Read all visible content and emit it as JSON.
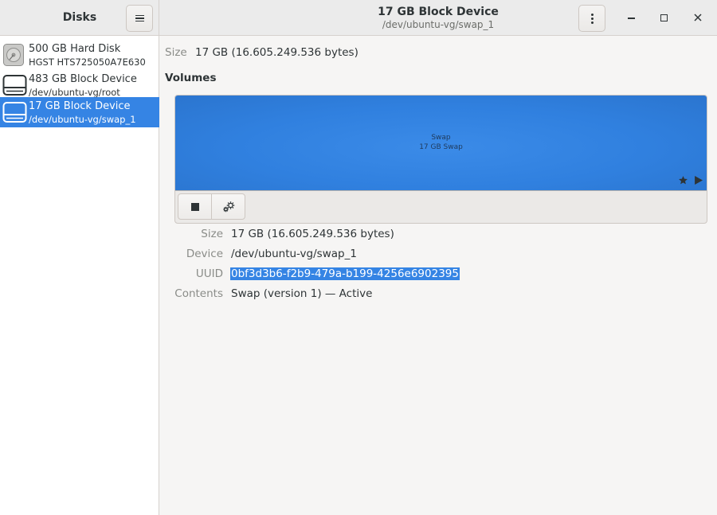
{
  "app": {
    "title": "Disks"
  },
  "header": {
    "device_title": "17 GB Block Device",
    "device_subtitle": "/dev/ubuntu-vg/swap_1"
  },
  "sidebar": {
    "items": [
      {
        "name": "500 GB Hard Disk",
        "sub": "HGST HTS725050A7E630",
        "icon": "hard-disk-icon",
        "selected": false
      },
      {
        "name": "483 GB Block Device",
        "sub": "/dev/ubuntu-vg/root",
        "icon": "block-device-icon",
        "selected": false
      },
      {
        "name": "17 GB Block Device",
        "sub": "/dev/ubuntu-vg/swap_1",
        "icon": "block-device-icon",
        "selected": true
      }
    ]
  },
  "device": {
    "size_label": "Size",
    "size_value": "17 GB (16.605.249.536 bytes)"
  },
  "volumes": {
    "section_title": "Volumes",
    "block": {
      "name": "Swap",
      "description": "17 GB Swap",
      "color": "#3584e4"
    }
  },
  "details": {
    "size_label": "Size",
    "size_value": "17 GB (16.605.249.536 bytes)",
    "device_label": "Device",
    "device_value": "/dev/ubuntu-vg/swap_1",
    "uuid_label": "UUID",
    "uuid_value": "0bf3d3b6-f2b9-479a-b199-4256e6902395",
    "contents_label": "Contents",
    "contents_value": "Swap (version 1) — Active"
  },
  "colors": {
    "accent": "#3584e4",
    "headerbar": "#ebebeb",
    "window_bg": "#f6f5f4"
  }
}
